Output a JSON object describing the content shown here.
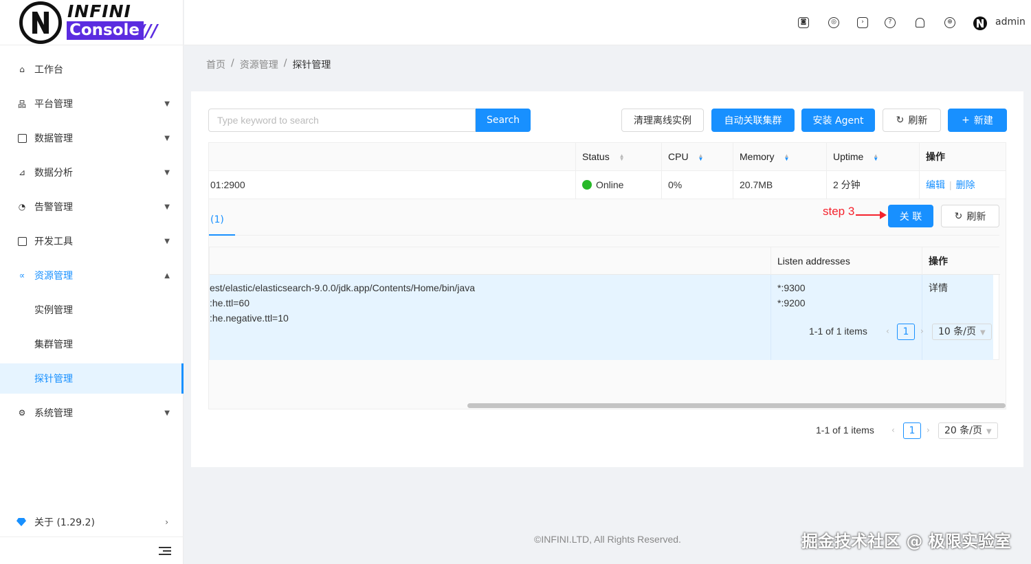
{
  "logo": {
    "line1": "INFINI",
    "line2": "Console",
    "slash": "///"
  },
  "user": {
    "name": "admin"
  },
  "header_icons": [
    "discord-icon",
    "github-icon",
    "terminal-icon",
    "help-icon",
    "bell-icon",
    "globe-icon"
  ],
  "menu": {
    "workbench": "工作台",
    "platform": "平台管理",
    "data": "数据管理",
    "analysis": "数据分析",
    "alert": "告警管理",
    "devtools": "开发工具",
    "resource": "资源管理",
    "instance": "实例管理",
    "cluster": "集群管理",
    "probe": "探针管理",
    "system": "系统管理",
    "about": "关于 (1.29.2)"
  },
  "breadcrumb": {
    "home": "首页",
    "sep": "/",
    "resource": "资源管理",
    "current": "探针管理"
  },
  "toolbar": {
    "search_placeholder": "Type keyword to search",
    "search_button": "Search",
    "clear_offline": "清理离线实例",
    "auto_associate": "自动关联集群",
    "install_agent": "安装 Agent",
    "refresh": "刷新",
    "new": "新建"
  },
  "table": {
    "headers": {
      "status": "Status",
      "cpu": "CPU",
      "memory": "Memory",
      "uptime": "Uptime",
      "actions": "操作"
    },
    "row": {
      "endpoint": "01:2900",
      "status": "Online",
      "cpu": "0%",
      "memory": "20.7MB",
      "uptime": "2 分钟",
      "edit": "编辑",
      "delete": "删除"
    }
  },
  "expanded": {
    "tab": "(1)",
    "annotation": "step 3",
    "associate_button": "关 联",
    "refresh_button": "刷新",
    "headers": {
      "listen": "Listen addresses",
      "actions": "操作"
    },
    "row": {
      "cmd_line1": "est/elastic/elasticsearch-9.0.0/jdk.app/Contents/Home/bin/java",
      "cmd_line2": ":he.ttl=60",
      "cmd_line3": ":he.negative.ttl=10",
      "addr1": "*:9300",
      "addr2": "*:9200",
      "detail": "详情"
    },
    "pagination": {
      "summary": "1-1 of 1 items",
      "page": "1",
      "size": "10 条/页"
    }
  },
  "pagination": {
    "summary": "1-1 of 1 items",
    "page": "1",
    "size": "20 条/页"
  },
  "footer": "©INFINI.LTD, All Rights Reserved.",
  "watermark": "掘金技术社区 @ 极限实验室",
  "colors": {
    "primary": "#1890ff",
    "brand": "#5b2ce0",
    "online": "#28b829",
    "annotation": "#f5222d"
  }
}
